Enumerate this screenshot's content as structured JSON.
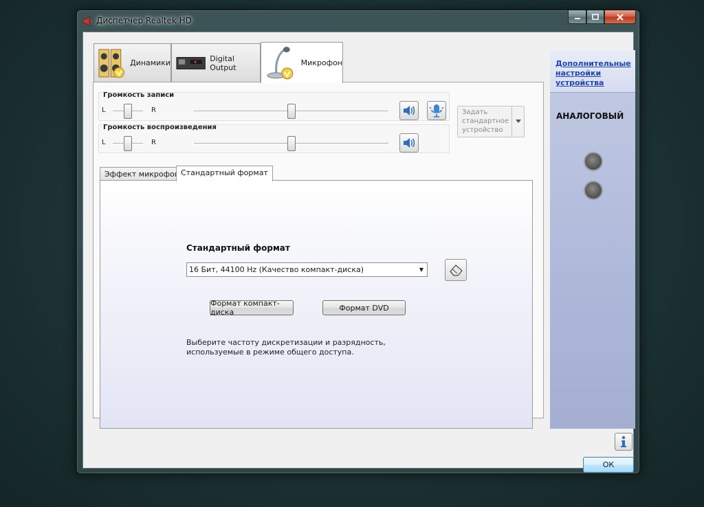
{
  "window": {
    "title": "Диспетчер Realtek HD",
    "icon": "speaker-icon"
  },
  "device_tabs": [
    {
      "label": "Динамики",
      "icon": "speakers-icon"
    },
    {
      "label": "Digital Output",
      "icon": "digital-output-icon"
    },
    {
      "label": "Микрофон",
      "icon": "microphone-icon",
      "active": true
    }
  ],
  "recording_volume": {
    "title": "Громкость записи",
    "left": "L",
    "right": "R",
    "balance": 0.5,
    "level": 0.5
  },
  "playback_volume": {
    "title": "Громкость воспроизведения",
    "left": "L",
    "right": "R",
    "balance": 0.5,
    "level": 0.5
  },
  "set_default": {
    "label": "Задать стандартное устройство"
  },
  "inner_tabs": [
    {
      "label": "Эффект микрофона"
    },
    {
      "label": "Стандартный формат",
      "active": true
    }
  ],
  "format": {
    "title": "Стандартный формат",
    "selected": "16 Бит, 44100 Hz (Качество компакт-диска)",
    "cd_button": "Формат компакт-диска",
    "dvd_button": "Формат DVD",
    "description": "Выберите частоту дискретизации и разрядность, используемые в режиме общего доступа."
  },
  "right_panel": {
    "advanced_link": "Дополнительные настройки устройства",
    "section": "АНАЛОГОВЫЙ"
  },
  "ok_button": "ОК"
}
